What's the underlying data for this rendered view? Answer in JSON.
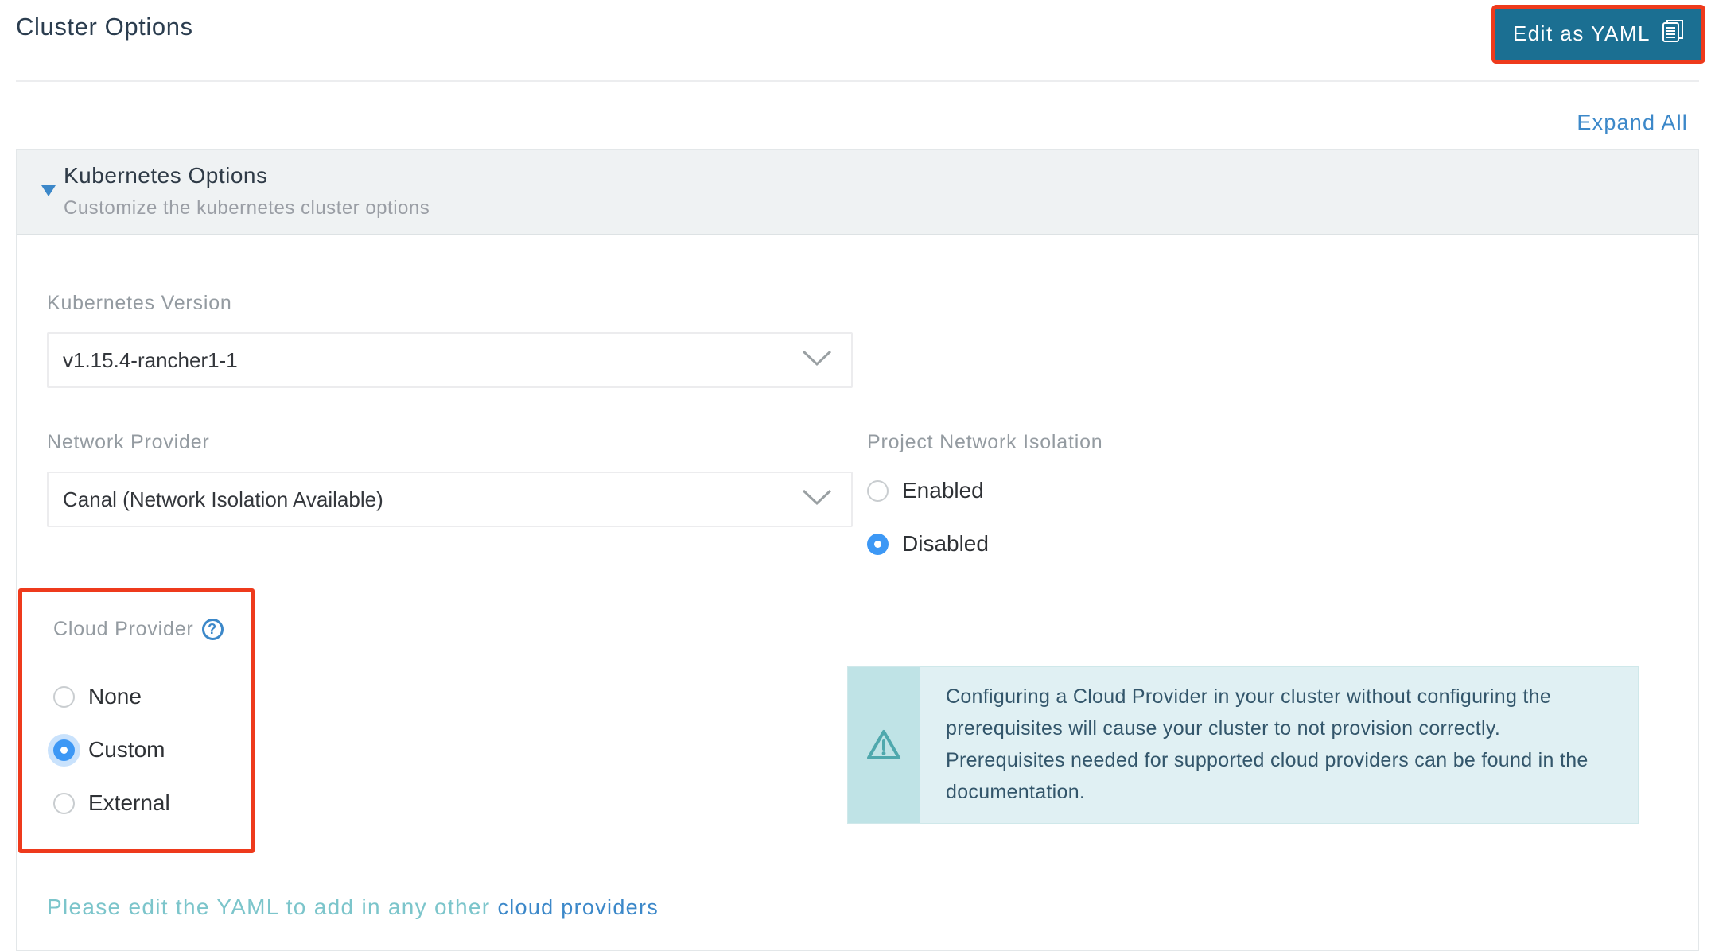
{
  "header": {
    "title": "Cluster Options",
    "edit_yaml_button": "Edit as YAML"
  },
  "toolbar": {
    "expand_all": "Expand All"
  },
  "section": {
    "title": "Kubernetes Options",
    "subtitle": "Customize the kubernetes cluster options"
  },
  "form": {
    "kubernetes_version": {
      "label": "Kubernetes Version",
      "value": "v1.15.4-rancher1-1"
    },
    "network_provider": {
      "label": "Network Provider",
      "value": "Canal (Network Isolation Available)"
    },
    "project_network_isolation": {
      "label": "Project Network Isolation",
      "options": [
        {
          "label": "Enabled",
          "selected": false
        },
        {
          "label": "Disabled",
          "selected": true
        }
      ]
    },
    "cloud_provider": {
      "label": "Cloud Provider",
      "help_glyph": "?",
      "options": [
        {
          "label": "None",
          "selected": false
        },
        {
          "label": "Custom",
          "selected": true
        },
        {
          "label": "External",
          "selected": false
        }
      ]
    },
    "alert": {
      "text": "Configuring a Cloud Provider in your cluster without configuring the prerequisites will cause your cluster to not provision correctly. Prerequisites needed for supported cloud providers can be found in the documentation."
    },
    "footer_note": {
      "text": "Please edit the YAML to add in any other ",
      "link": "cloud providers"
    }
  },
  "colors": {
    "accent_blue": "#3c88c9",
    "button_blue": "#1b6f92",
    "highlight_red": "#ee3a1c",
    "radio_selected_blue": "#3d98f5",
    "alert_strip": "#bfe3e6",
    "alert_body": "#e0f0f3",
    "alert_icon_teal": "#4fa8ad",
    "note_teal": "#7cc5cb"
  }
}
